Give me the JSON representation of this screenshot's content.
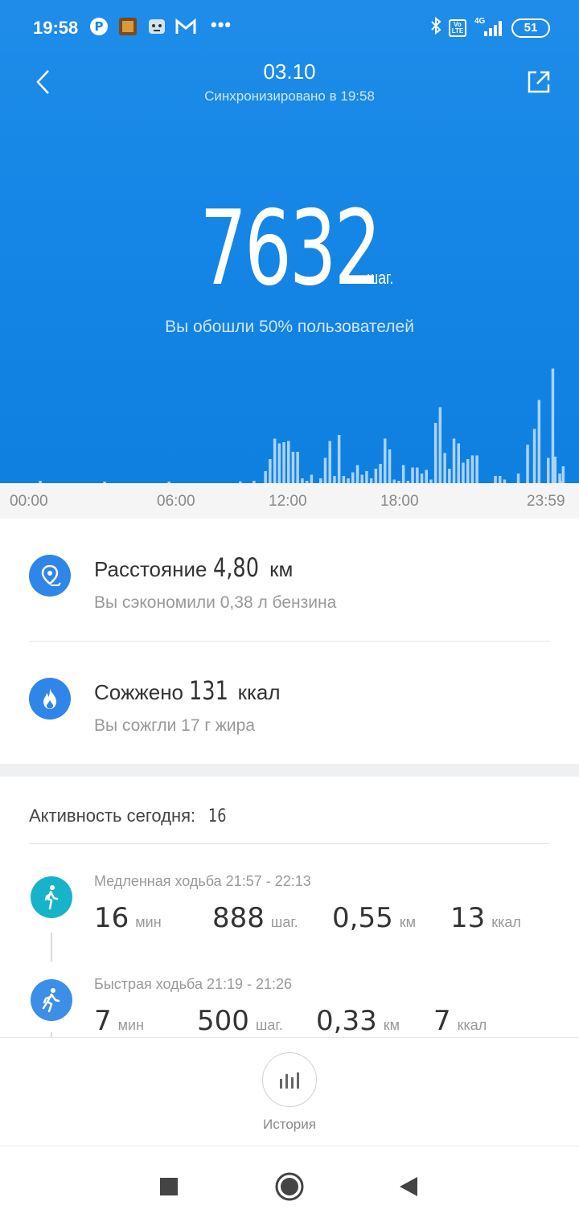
{
  "status_bar": {
    "time": "19:58",
    "icons": [
      "pinterest-icon",
      "app-avatar-icon",
      "robot-icon",
      "gmail-icon",
      "more-dots-icon",
      "bluetooth-icon",
      "volte-icon",
      "signal-4g-icon"
    ],
    "more": "•••",
    "volte": "Vo LTE",
    "network": "4G",
    "battery": "51"
  },
  "header": {
    "date": "03.10",
    "sync_status": "Синхронизировано в 19:58"
  },
  "summary": {
    "steps": "7632",
    "steps_unit": "шаг.",
    "percentile_text": "Вы обошли 50% пользователей"
  },
  "chart_data": {
    "type": "bar",
    "x_ticks": [
      "00:00",
      "06:00",
      "12:00",
      "18:00",
      "23:59"
    ],
    "x_range_hours": [
      0,
      24
    ],
    "bars": [
      {
        "x": 1.2,
        "y": 2
      },
      {
        "x": 4.0,
        "y": 1
      },
      {
        "x": 6.8,
        "y": 1
      },
      {
        "x": 9.9,
        "y": 1.5
      },
      {
        "x": 10.5,
        "y": 2
      },
      {
        "x": 11.0,
        "y": 10
      },
      {
        "x": 11.2,
        "y": 20
      },
      {
        "x": 11.4,
        "y": 37
      },
      {
        "x": 11.6,
        "y": 33
      },
      {
        "x": 11.8,
        "y": 34
      },
      {
        "x": 12.0,
        "y": 35
      },
      {
        "x": 12.2,
        "y": 26
      },
      {
        "x": 12.4,
        "y": 26
      },
      {
        "x": 12.6,
        "y": 4
      },
      {
        "x": 12.8,
        "y": 2
      },
      {
        "x": 13.0,
        "y": 7
      },
      {
        "x": 13.4,
        "y": 4
      },
      {
        "x": 13.6,
        "y": 21
      },
      {
        "x": 13.8,
        "y": 35
      },
      {
        "x": 14.0,
        "y": 6
      },
      {
        "x": 14.2,
        "y": 40
      },
      {
        "x": 14.4,
        "y": 6
      },
      {
        "x": 14.6,
        "y": 4
      },
      {
        "x": 14.8,
        "y": 9
      },
      {
        "x": 15.0,
        "y": 15
      },
      {
        "x": 15.2,
        "y": 7
      },
      {
        "x": 15.4,
        "y": 10
      },
      {
        "x": 15.6,
        "y": 4
      },
      {
        "x": 15.8,
        "y": 12
      },
      {
        "x": 16.0,
        "y": 16
      },
      {
        "x": 16.2,
        "y": 37
      },
      {
        "x": 16.4,
        "y": 28
      },
      {
        "x": 16.6,
        "y": 3
      },
      {
        "x": 16.8,
        "y": 2
      },
      {
        "x": 17.0,
        "y": 15
      },
      {
        "x": 17.2,
        "y": 2
      },
      {
        "x": 17.4,
        "y": 13
      },
      {
        "x": 17.6,
        "y": 13
      },
      {
        "x": 17.8,
        "y": 8
      },
      {
        "x": 18.0,
        "y": 11
      },
      {
        "x": 18.2,
        "y": 3
      },
      {
        "x": 18.4,
        "y": 50
      },
      {
        "x": 18.6,
        "y": 63
      },
      {
        "x": 18.8,
        "y": 25
      },
      {
        "x": 19.0,
        "y": 12
      },
      {
        "x": 19.2,
        "y": 37
      },
      {
        "x": 19.4,
        "y": 33
      },
      {
        "x": 19.6,
        "y": 17
      },
      {
        "x": 19.8,
        "y": 20
      },
      {
        "x": 20.0,
        "y": 23
      },
      {
        "x": 20.2,
        "y": 23
      },
      {
        "x": 21.0,
        "y": 6
      },
      {
        "x": 21.2,
        "y": 6
      },
      {
        "x": 21.4,
        "y": 3
      },
      {
        "x": 22.0,
        "y": 8
      },
      {
        "x": 22.4,
        "y": 32
      },
      {
        "x": 22.7,
        "y": 45
      },
      {
        "x": 22.9,
        "y": 69
      },
      {
        "x": 23.3,
        "y": 21
      },
      {
        "x": 23.5,
        "y": 95
      },
      {
        "x": 23.6,
        "y": 22
      },
      {
        "x": 23.8,
        "y": 8
      },
      {
        "x": 23.9,
        "y": 2
      },
      {
        "x": 23.95,
        "y": 14
      }
    ]
  },
  "distance": {
    "label": "Расстояние",
    "value": "4,80",
    "unit": "км",
    "note": "Вы сэкономили 0,38 л бензина"
  },
  "calories": {
    "label": "Сожжено",
    "value": "131",
    "unit": "ккал",
    "note": "Вы сожгли 17 г жира"
  },
  "activity": {
    "header": "Активность сегодня:",
    "count": "16",
    "items": [
      {
        "title": "Медленная ходьба 21:57 - 22:13",
        "icon": "walking-person-icon",
        "color": "#17b4c9",
        "minutes": "16",
        "minutes_unit": "мин",
        "steps": "888",
        "steps_unit": "шаг.",
        "distance": "0,55",
        "distance_unit": "км",
        "kcal": "13",
        "kcal_unit": "ккал"
      },
      {
        "title": "Быстрая ходьба 21:19 - 21:26",
        "icon": "fast-walking-icon",
        "color": "#3d8ee6",
        "minutes": "7",
        "minutes_unit": "мин",
        "steps": "500",
        "steps_unit": "шаг.",
        "distance": "0,33",
        "distance_unit": "км",
        "kcal": "7",
        "kcal_unit": "ккал"
      }
    ]
  },
  "history_button": {
    "label": "История"
  },
  "colors": {
    "hero_blue": "#1687e6",
    "distance_icon": "#2f86e8",
    "calories_icon": "#2f86e8"
  }
}
